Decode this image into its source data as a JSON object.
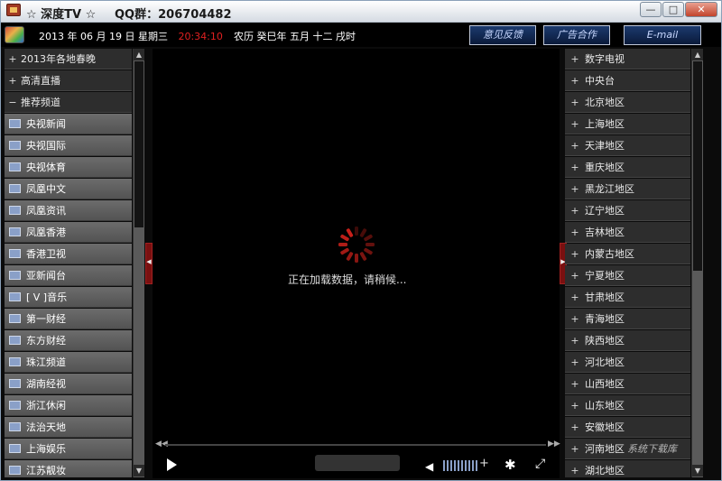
{
  "window": {
    "title": "☆ 深度TV ☆",
    "qq_group": "QQ群：206704482",
    "controls": {
      "minimize": "—",
      "maximize": "□",
      "close": "✕"
    }
  },
  "infobar": {
    "date": "2013 年 06 月 19 日  星期三",
    "time": "20:34:10",
    "lunar": "农历 癸巳年 五月 十二 戌时",
    "buttons": {
      "feedback": "意见反馈",
      "ad": "广告合作",
      "email": "E-mail"
    }
  },
  "left_panel": {
    "categories": [
      {
        "sign": "+",
        "label": "2013年各地春晚"
      },
      {
        "sign": "+",
        "label": "高清直播"
      },
      {
        "sign": "−",
        "label": "推荐频道"
      }
    ],
    "channels": [
      "央视新闻",
      "央视国际",
      "央视体育",
      "凤凰中文",
      "凤凰资讯",
      "凤凰香港",
      "香港卫视",
      "亚新闻台",
      "[ V ]音乐",
      "第一财经",
      "东方财经",
      "珠江频道",
      "湖南经视",
      "浙江休闲",
      "法治天地",
      "上海娱乐",
      "江苏靓妆"
    ]
  },
  "player": {
    "loading_text": "正在加载数据，请稍候...",
    "left_tab_arrow": "◀",
    "right_tab_arrow": "▶",
    "progress_left": "◀◀",
    "progress_right": "▶▶",
    "icons": {
      "play": "play-icon",
      "speaker": "speaker-icon",
      "gear": "gear-icon",
      "fullscreen": "fullscreen-icon"
    },
    "volume_plus": "+"
  },
  "right_panel": {
    "regions": [
      "数字电视",
      "中央台",
      "北京地区",
      "上海地区",
      "天津地区",
      "重庆地区",
      "黑龙江地区",
      "辽宁地区",
      "吉林地区",
      "内蒙古地区",
      "宁夏地区",
      "甘肃地区",
      "青海地区",
      "陕西地区",
      "河北地区",
      "山西地区",
      "山东地区",
      "安徽地区",
      "河南地区",
      "湖北地区"
    ]
  },
  "watermark": "系统下载库",
  "colors": {
    "accent": "#e02020",
    "panel": "#2d2d2d",
    "channel": "#5f5f5f",
    "spinner": "#c8201a"
  }
}
